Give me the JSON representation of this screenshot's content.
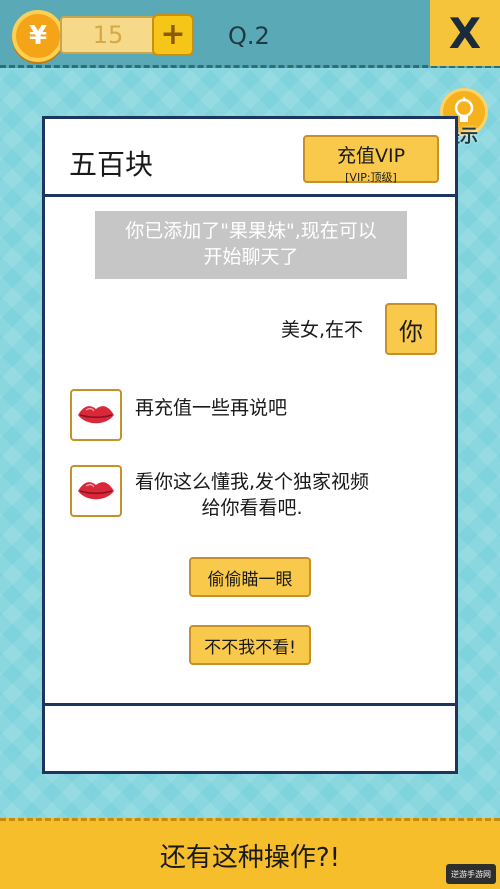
{
  "topbar": {
    "coin_symbol": "¥",
    "coin_count": "15",
    "plus_label": "+",
    "level_label": "Q.2",
    "close_label": "X"
  },
  "hint": {
    "label": "提示"
  },
  "chat": {
    "contact_name": "五百块",
    "vip_button": {
      "label": "充值VIP",
      "sub": "[VIP:顶级]"
    },
    "system_notice": [
      "你已添加了\"果果妹\",现在可以",
      "开始聊天了"
    ],
    "my_message": "美女,在不",
    "my_avatar_text": "你",
    "contact_messages": [
      {
        "lines": [
          "再充值一些再说吧"
        ],
        "avatar_icon": "lips-icon"
      },
      {
        "lines": [
          "看你这么懂我,发个独家视频",
          "给你看看吧."
        ],
        "avatar_icon": "lips-icon"
      }
    ],
    "reply_options": [
      "偷偷瞄一眼",
      "不不我不看!"
    ]
  },
  "bottom_banner": {
    "title": "还有这种操作?!"
  },
  "watermark": {
    "text": "逆游手游网"
  },
  "colors": {
    "background": "#7ed3dc",
    "topbar": "#5aa9b6",
    "accent_yellow": "#f8c94b",
    "card_border": "#1e3560",
    "lips": "#d8283a"
  }
}
